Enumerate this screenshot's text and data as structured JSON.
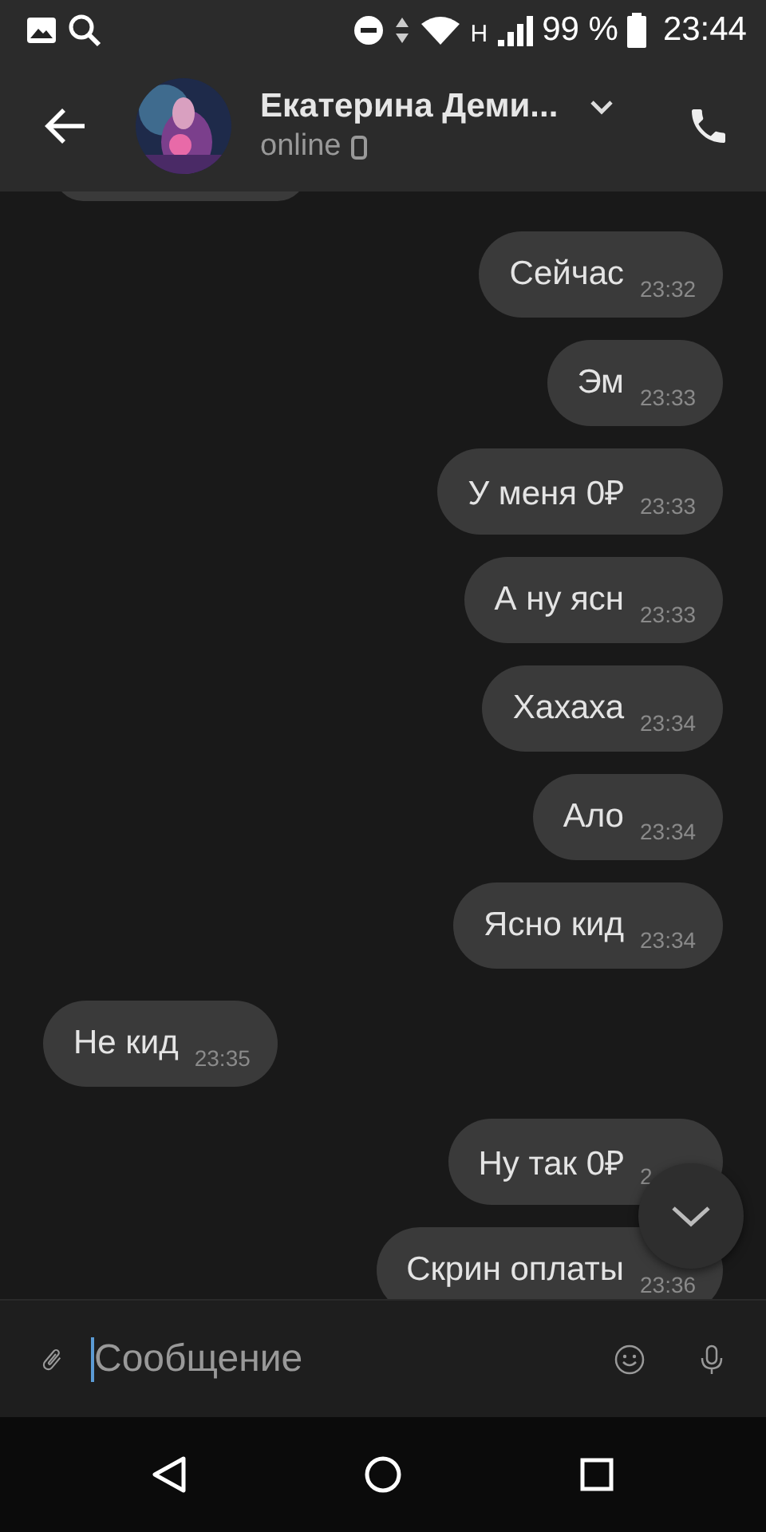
{
  "status_bar": {
    "battery": "99 %",
    "network": "H",
    "time": "23:44"
  },
  "header": {
    "name": "Екатерина Деми...",
    "status": "online"
  },
  "messages": [
    {
      "text": "Сейчас",
      "time": "23:32",
      "outgoing": true
    },
    {
      "text": "Эм",
      "time": "23:33",
      "outgoing": true
    },
    {
      "text": "У меня 0₽",
      "time": "23:33",
      "outgoing": true
    },
    {
      "text": "А ну ясн",
      "time": "23:33",
      "outgoing": true
    },
    {
      "text": "Хахаха",
      "time": "23:34",
      "outgoing": true
    },
    {
      "text": "Ало",
      "time": "23:34",
      "outgoing": true
    },
    {
      "text": "Ясно кид",
      "time": "23:34",
      "outgoing": true
    },
    {
      "text": "Не кид",
      "time": "23:35",
      "outgoing": false
    },
    {
      "text": "Ну так 0₽",
      "time": "2",
      "outgoing": true
    },
    {
      "text": "Скрин оплаты",
      "time": "23:36",
      "outgoing": true
    }
  ],
  "composer": {
    "placeholder": "Сообщение"
  }
}
